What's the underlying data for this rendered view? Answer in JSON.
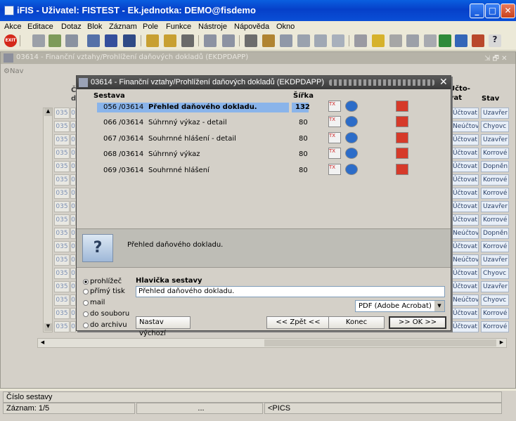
{
  "window": {
    "title": "iFIS - Uživatel: FISTEST - Ek.jednotka: DEMO@fisdemo"
  },
  "menu": [
    "Akce",
    "Editace",
    "Dotaz",
    "Blok",
    "Záznam",
    "Pole",
    "Funkce",
    "Nástroje",
    "Nápověda",
    "Okno"
  ],
  "mdi": {
    "title": "03614 - Finanční vztahy/Prohlížení daňových dokladů (EKDPDAPP)",
    "nav": "Nav",
    "col_header_partial": "Č",
    "col_header_partial2": "d",
    "right_headers": {
      "ucto_line1": "Účto-",
      "ucto_line2": "vat",
      "stav": "Stav"
    },
    "rows": [
      {
        "code": "035",
        "c2": "0",
        "ucto": "Účtovat",
        "stav": "Uzavřer"
      },
      {
        "code": "035",
        "c2": "0",
        "ucto": "Neúčtov",
        "stav": "Chyovc"
      },
      {
        "code": "035",
        "c2": "0",
        "ucto": "Účtovat",
        "stav": "Uzavřer"
      },
      {
        "code": "035",
        "c2": "0",
        "ucto": "Účtovat",
        "stav": "Korrové"
      },
      {
        "code": "035",
        "c2": "0",
        "ucto": "Účtovat",
        "stav": "Dopněn"
      },
      {
        "code": "035",
        "c2": "0",
        "ucto": "Účtovat",
        "stav": "Korrové"
      },
      {
        "code": "035",
        "c2": "0",
        "ucto": "Účtovat",
        "stav": "Korrové"
      },
      {
        "code": "035",
        "c2": "0",
        "ucto": "Účtovat",
        "stav": "Uzavřer"
      },
      {
        "code": "035",
        "c2": "0",
        "ucto": "Účtovat",
        "stav": "Korrové"
      },
      {
        "code": "035",
        "c2": "0",
        "ucto": "Neúčtov",
        "stav": "Dopněn"
      },
      {
        "code": "035",
        "c2": "0",
        "ucto": "Účtovat",
        "stav": "Korrové"
      },
      {
        "code": "035",
        "c2": "0",
        "ucto": "Neúčtov",
        "stav": "Uzavřer"
      },
      {
        "code": "035",
        "c2": "0",
        "ucto": "Účtovat",
        "stav": "Chyovc"
      },
      {
        "code": "035",
        "c2": "0",
        "ucto": "Účtovat",
        "stav": "Uzavřer"
      },
      {
        "code": "035",
        "c2": "0",
        "ucto": "Neúčtov",
        "stav": "Chyovc"
      },
      {
        "code": "035",
        "c2": "0",
        "ucto": "Účtovat",
        "stav": "Korrové"
      },
      {
        "code": "035",
        "c2": "0",
        "ucto": "Účtovat",
        "stav": "Korrové"
      }
    ]
  },
  "dialog": {
    "title": "03614 - Finanční vztahy/Prohlížení daňových dokladů (EKDPDAPP)",
    "headers": {
      "sestava": "Sestava",
      "sirka": "Šířka"
    },
    "reports": [
      {
        "num": "056",
        "code": "/03614",
        "name": "Přehled daňového dokladu.",
        "width": "132",
        "selected": true
      },
      {
        "num": "066",
        "code": "/03614",
        "name": "Súhrnný výkaz - detail",
        "width": "80",
        "selected": false
      },
      {
        "num": "067",
        "code": "/03614",
        "name": "Souhrnné hlášení - detail",
        "width": "80",
        "selected": false
      },
      {
        "num": "068",
        "code": "/03614",
        "name": "Súhrnný výkaz",
        "width": "80",
        "selected": false
      },
      {
        "num": "069",
        "code": "/03614",
        "name": "Souhrnné hlášení",
        "width": "80",
        "selected": false
      }
    ],
    "description": "Přehled daňového dokladu.",
    "output_options": [
      "prohlížeč",
      "přímý tisk",
      "mail",
      "do souboru",
      "do archivu"
    ],
    "selected_output": "prohlížeč",
    "header_label": "Hlavička sestavy",
    "header_value": "Přehled daňového dokladu.",
    "format_select": "PDF (Adobe Acrobat)",
    "buttons": {
      "defaults": "Nastav výchozí",
      "back": "<< Zpět <<",
      "end": "Konec",
      "ok": ">> OK >>"
    }
  },
  "status": {
    "line1": "Číslo sestavy",
    "record": "Záznam: 1/5",
    "seg2": "...",
    "mode": "<PICS"
  }
}
